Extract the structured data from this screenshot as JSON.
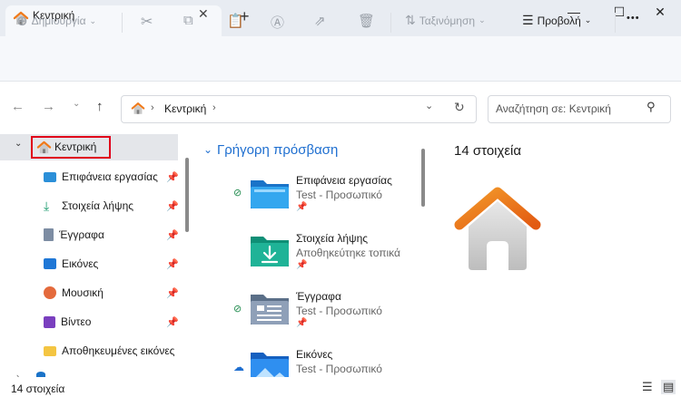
{
  "tab": {
    "title": "Κεντρική"
  },
  "toolbar": {
    "create_label": "Δημιουργία",
    "sort_label": "Ταξινόμηση",
    "view_label": "Προβολή",
    "more_label": "•••"
  },
  "address": {
    "crumb": "Κεντρική"
  },
  "search": {
    "placeholder": "Αναζήτηση σε: Κεντρική"
  },
  "nav": {
    "home_label": "Κεντρική",
    "items": [
      {
        "label": "Επιφάνεια εργασίας",
        "icon": "desktop-icon"
      },
      {
        "label": "Στοιχεία λήψης",
        "icon": "download-icon"
      },
      {
        "label": "Έγγραφα",
        "icon": "document-icon"
      },
      {
        "label": "Εικόνες",
        "icon": "pictures-icon"
      },
      {
        "label": "Μουσική",
        "icon": "music-icon"
      },
      {
        "label": "Βίντεο",
        "icon": "video-icon"
      },
      {
        "label": "Αποθηκευμένες εικόνες",
        "icon": "folder-icon"
      }
    ]
  },
  "quick_access": {
    "header": "Γρήγορη πρόσβαση",
    "items": [
      {
        "name": "Επιφάνεια εργασίας",
        "sub": "Test - Προσωπικό"
      },
      {
        "name": "Στοιχεία λήψης",
        "sub": "Αποθηκεύτηκε τοπικά"
      },
      {
        "name": "Έγγραφα",
        "sub": "Test - Προσωπικό"
      },
      {
        "name": "Εικόνες",
        "sub": "Test - Προσωπικό"
      }
    ]
  },
  "preview": {
    "count": "14 στοιχεία"
  },
  "status": {
    "count": "14 στοιχεία"
  },
  "colors": {
    "accent": "#1f6fd0",
    "highlight": "#e0001a",
    "home_orange": "#f07a1a"
  }
}
